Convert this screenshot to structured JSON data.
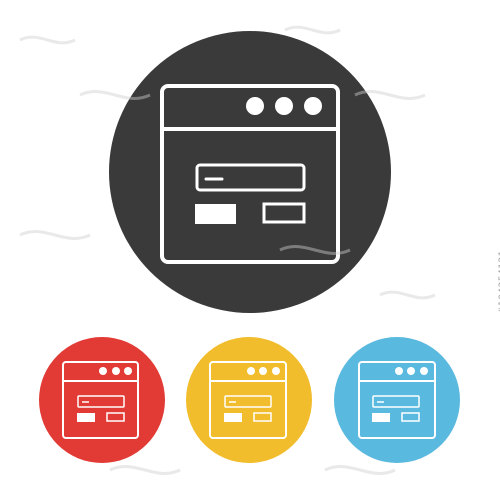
{
  "icons": [
    {
      "name": "browser-window-icon-large",
      "circle_color": "#3a3a3a",
      "line_color": "#ffffff",
      "semantic": "browser-window-login-icon"
    },
    {
      "name": "browser-window-icon-red",
      "circle_color": "#e23b36",
      "line_color": "#ffffff",
      "semantic": "browser-window-login-icon"
    },
    {
      "name": "browser-window-icon-yellow",
      "circle_color": "#f2bd2c",
      "line_color": "#ffffff",
      "semantic": "browser-window-login-icon"
    },
    {
      "name": "browser-window-icon-blue",
      "circle_color": "#5ab9df",
      "line_color": "#ffffff",
      "semantic": "browser-window-login-icon"
    }
  ],
  "watermark": {
    "side_id": "#104254121",
    "logo": "adobe-stock-watermark"
  }
}
